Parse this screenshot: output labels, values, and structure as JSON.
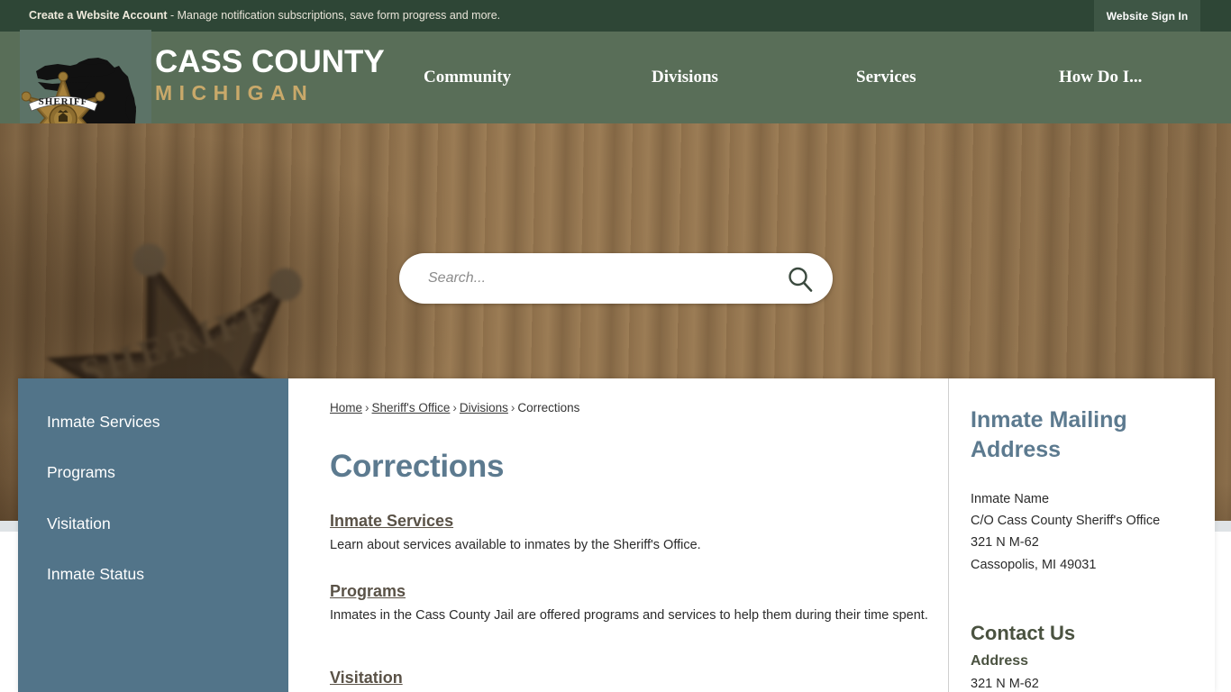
{
  "topbar": {
    "account_bold": "Create a Website Account",
    "account_rest": " - Manage notification subscriptions, save form progress and more.",
    "signin_label": "Website Sign In"
  },
  "header": {
    "site_title_line1": "CASS COUNTY",
    "site_title_line2": "MICHIGAN",
    "logo_icon": "sheriff-star-michigan-logo",
    "nav": [
      {
        "label": "Community"
      },
      {
        "label": "Divisions"
      },
      {
        "label": "Services"
      },
      {
        "label": "How Do I..."
      }
    ]
  },
  "hero": {
    "search": {
      "placeholder": "Search...",
      "value": "",
      "icon": "search-icon"
    }
  },
  "sidebar": {
    "items": [
      {
        "label": "Inmate Services"
      },
      {
        "label": "Programs"
      },
      {
        "label": "Visitation"
      },
      {
        "label": "Inmate Status"
      }
    ]
  },
  "main": {
    "breadcrumb": [
      {
        "label": "Home",
        "link": true
      },
      {
        "label": "Sheriff's Office",
        "link": true
      },
      {
        "label": "Divisions",
        "link": true
      },
      {
        "label": "Corrections",
        "link": false
      }
    ],
    "breadcrumb_separator": "›",
    "page_title": "Corrections",
    "sections": [
      {
        "link": "Inmate Services",
        "description": "Learn about services available to inmates by the Sheriff's Office."
      },
      {
        "link": "Programs",
        "description": "Inmates in the Cass County Jail are offered programs and services to help them during their time spent."
      },
      {
        "link": "Visitation",
        "description": ""
      }
    ]
  },
  "rail": {
    "mailing_heading": "Inmate Mailing Address",
    "mailing_lines": [
      "Inmate Name",
      "C/O Cass County Sheriff's Office",
      "321 N M-62",
      "Cassopolis, MI 49031"
    ],
    "contact_heading": "Contact Us",
    "address_label": "Address",
    "address_line": "321 N M-62"
  },
  "colors": {
    "topbar_green": "#2e4636",
    "header_green": "#596e58",
    "gold": "#c9a96a",
    "slate_blue": "#5c7a8f",
    "sidebar_blue": "#527489",
    "olive": "#4a5240"
  }
}
